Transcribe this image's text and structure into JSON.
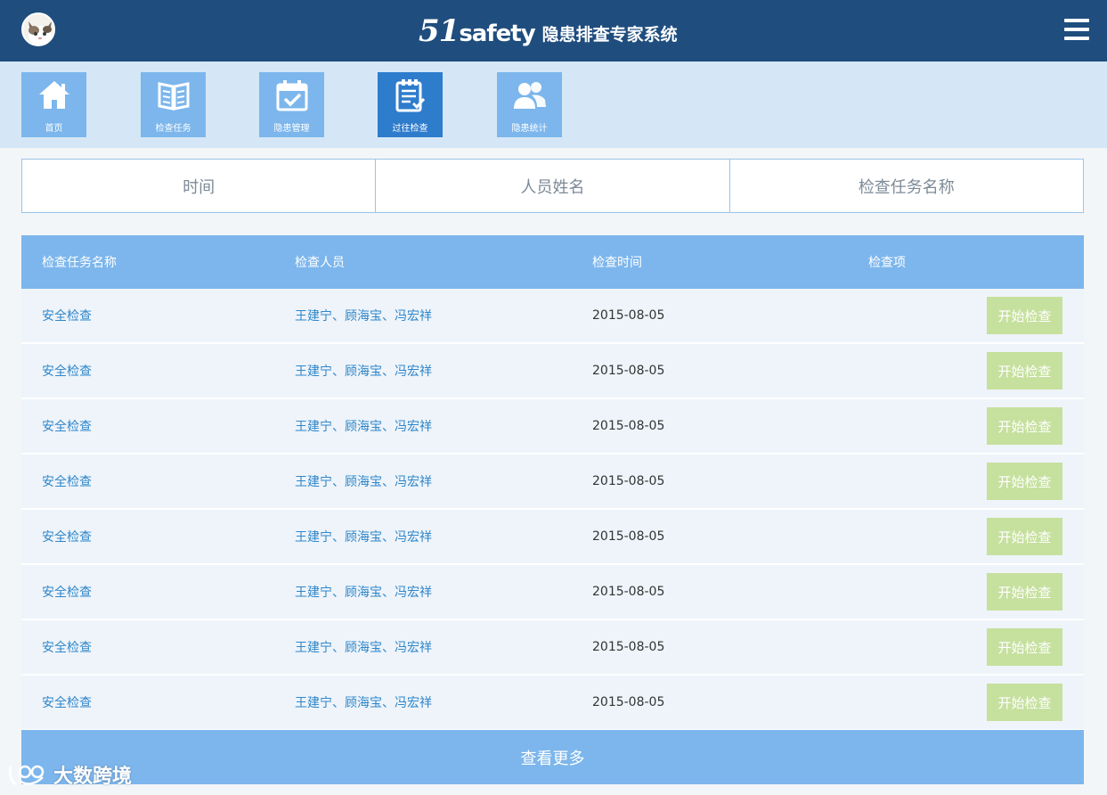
{
  "header": {
    "brand_number": "51",
    "brand_word": "safety",
    "brand_name": "隐患排查专家系统",
    "bg_color": "#1f4d7e"
  },
  "nav": {
    "items": [
      {
        "label": "首页",
        "icon": "home-icon",
        "active": false
      },
      {
        "label": "检查任务",
        "icon": "book-icon",
        "active": false
      },
      {
        "label": "隐患管理",
        "icon": "calendar-check-icon",
        "active": false
      },
      {
        "label": "过往检查",
        "icon": "clipboard-check-icon",
        "active": true
      },
      {
        "label": "隐患统计",
        "icon": "users-icon",
        "active": false
      }
    ]
  },
  "filters": {
    "tabs": [
      "时间",
      "人员姓名",
      "检查任务名称"
    ]
  },
  "table": {
    "columns": [
      "检查任务名称",
      "检查人员",
      "检查时间",
      "检查项"
    ],
    "rows": [
      {
        "task": "安全检查",
        "inspectors": "王建宁、顾海宝、冯宏祥",
        "date": "2015-08-05",
        "action": "开始检查"
      },
      {
        "task": "安全检查",
        "inspectors": "王建宁、顾海宝、冯宏祥",
        "date": "2015-08-05",
        "action": "开始检查"
      },
      {
        "task": "安全检查",
        "inspectors": "王建宁、顾海宝、冯宏祥",
        "date": "2015-08-05",
        "action": "开始检查"
      },
      {
        "task": "安全检查",
        "inspectors": "王建宁、顾海宝、冯宏祥",
        "date": "2015-08-05",
        "action": "开始检查"
      },
      {
        "task": "安全检查",
        "inspectors": "王建宁、顾海宝、冯宏祥",
        "date": "2015-08-05",
        "action": "开始检查"
      },
      {
        "task": "安全检查",
        "inspectors": "王建宁、顾海宝、冯宏祥",
        "date": "2015-08-05",
        "action": "开始检查"
      },
      {
        "task": "安全检查",
        "inspectors": "王建宁、顾海宝、冯宏祥",
        "date": "2015-08-05",
        "action": "开始检查"
      },
      {
        "task": "安全检查",
        "inspectors": "王建宁、顾海宝、冯宏祥",
        "date": "2015-08-05",
        "action": "开始检查"
      }
    ]
  },
  "more_label": "查看更多",
  "watermark": "大数跨境",
  "colors": {
    "accent": "#7cb6ec",
    "active_nav": "#2e7ccc",
    "start_button": "#c6e09e",
    "link_text": "#2f86c9"
  }
}
